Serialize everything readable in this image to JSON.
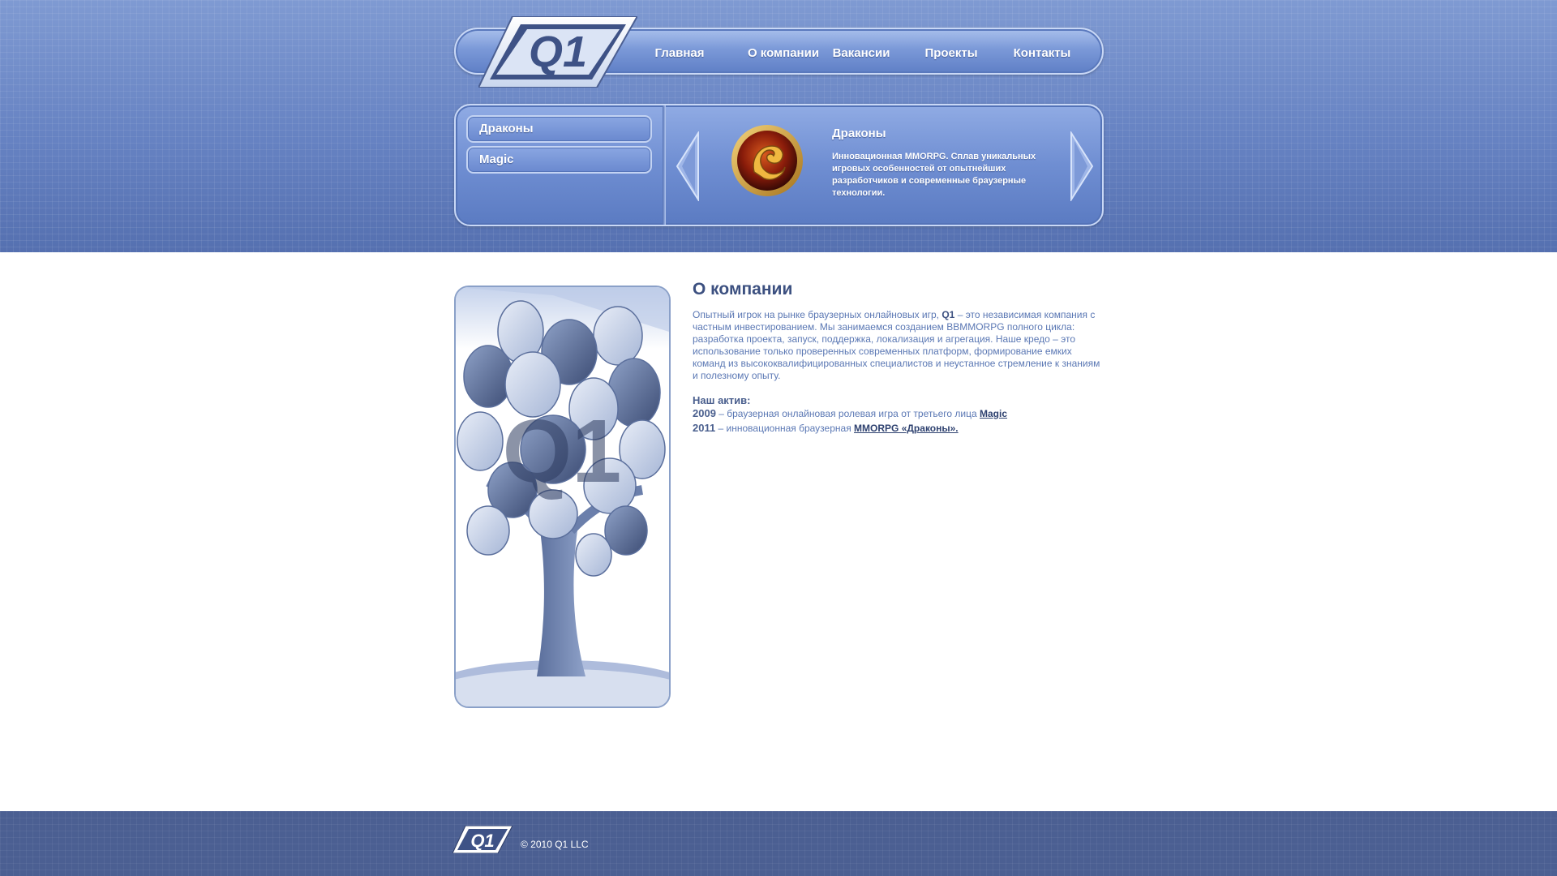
{
  "nav": {
    "items": [
      {
        "label": "Главная"
      },
      {
        "label": "О компании"
      },
      {
        "label": "Вакансии"
      },
      {
        "label": "Проекты"
      },
      {
        "label": "Контакты"
      }
    ]
  },
  "projects": {
    "tabs": [
      {
        "label": "Драконы"
      },
      {
        "label": "Magic"
      }
    ],
    "featured": {
      "title": "Драконы",
      "description": "Инновационная MMORPG. Сплав уникальных игровых особенностей от опытнейших разработчиков и современные браузерные технологии."
    }
  },
  "main": {
    "title": "О компании",
    "intro_before": "Опытный игрок на рынке браузерных онлайновых игр, ",
    "intro_brand": "Q1",
    "intro_after": " – это независимая компания с частным инвестированием. Мы занимаемся созданием BBMMORPG полного цикла: разработка проекта, запуск, поддержка, локализация и агрегация. Наше кредо – это использование только проверенных современных платформ, формирование емких команд из высококвалифицированных специалистов и неустанное стремление к знаниям и полезному опыту.",
    "assets_heading": "Наш актив:",
    "assets": [
      {
        "year": "2009",
        "text": " – браузерная онлайновая ролевая игра от третьего лица ",
        "link": "Magic"
      },
      {
        "year": "2011",
        "text": " – инновационная браузерная ",
        "link": "MMORPG «Драконы»."
      }
    ]
  },
  "footer": {
    "copyright": "© 2010 Q1 LLC"
  },
  "icons": {
    "logo": "q1-logo",
    "prev": "arrow-left-icon",
    "next": "arrow-right-icon",
    "game": "dragon-emblem-icon",
    "illustration": "tree-illustration"
  },
  "colors": {
    "header_bg": "#6a86c4",
    "footer_bg": "#4b5f92",
    "title": "#3c5080",
    "body_text": "#5b78b4"
  }
}
